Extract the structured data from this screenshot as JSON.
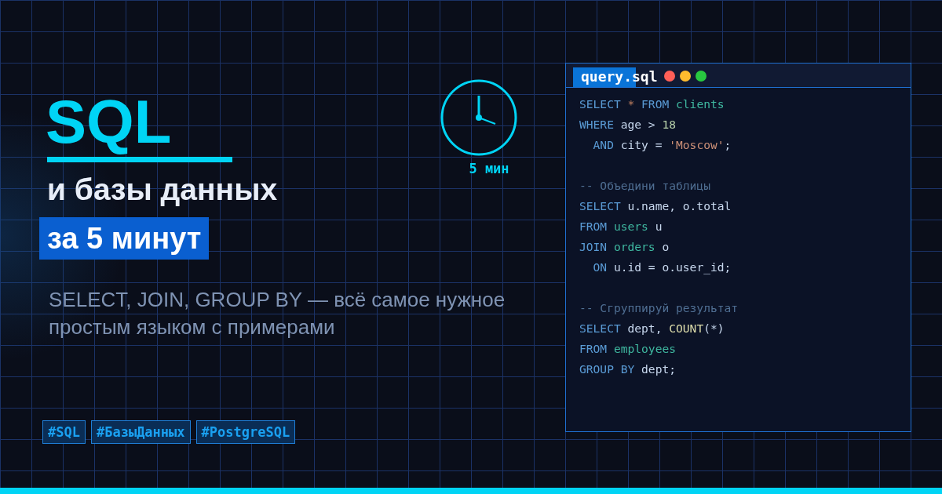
{
  "title": "SQL",
  "heading": "и базы данных",
  "badge": "за 5 минут",
  "subtitle": "SELECT, JOIN, GROUP BY — всё самое нужное простым языком с примерами",
  "tags": [
    "#SQL",
    "#БазыДанных",
    "#PostgreSQL"
  ],
  "timer": {
    "label": "5 мин"
  },
  "editor": {
    "tab": "query.sql",
    "lines": [
      {
        "kind": "code",
        "tokens": [
          {
            "kind": "kw",
            "text": "SELECT"
          },
          {
            "kind": "op",
            "text": " * "
          },
          {
            "kind": "kw",
            "text": "FROM"
          },
          {
            "kind": "tbl",
            "text": " clients"
          }
        ]
      },
      {
        "kind": "code",
        "tokens": [
          {
            "kind": "kw",
            "text": "WHERE"
          },
          {
            "kind": "id",
            "text": " age > "
          },
          {
            "kind": "num",
            "text": "18"
          }
        ]
      },
      {
        "kind": "code",
        "tokens": [
          {
            "kind": "kw",
            "text": "  AND"
          },
          {
            "kind": "id",
            "text": " city = "
          },
          {
            "kind": "str",
            "text": "'Moscow'"
          },
          {
            "kind": "id",
            "text": ";"
          }
        ]
      },
      {
        "kind": "blank"
      },
      {
        "kind": "code",
        "tokens": [
          {
            "kind": "cm",
            "text": "-- Объедини таблицы"
          }
        ]
      },
      {
        "kind": "code",
        "tokens": [
          {
            "kind": "kw",
            "text": "SELECT"
          },
          {
            "kind": "id",
            "text": " u.name, o.total"
          }
        ]
      },
      {
        "kind": "code",
        "tokens": [
          {
            "kind": "kw",
            "text": "FROM"
          },
          {
            "kind": "tbl",
            "text": " users"
          },
          {
            "kind": "id",
            "text": " u"
          }
        ]
      },
      {
        "kind": "code",
        "tokens": [
          {
            "kind": "kw",
            "text": "JOIN"
          },
          {
            "kind": "tbl",
            "text": " orders"
          },
          {
            "kind": "id",
            "text": " o"
          }
        ]
      },
      {
        "kind": "code",
        "tokens": [
          {
            "kind": "kw",
            "text": "  ON"
          },
          {
            "kind": "id",
            "text": " u.id = o.user_id;"
          }
        ]
      },
      {
        "kind": "blank"
      },
      {
        "kind": "code",
        "tokens": [
          {
            "kind": "cm",
            "text": "-- Сгруппируй результат"
          }
        ]
      },
      {
        "kind": "code",
        "tokens": [
          {
            "kind": "kw",
            "text": "SELECT"
          },
          {
            "kind": "id",
            "text": " dept, "
          },
          {
            "kind": "fn",
            "text": "COUNT"
          },
          {
            "kind": "id",
            "text": "(*)"
          }
        ]
      },
      {
        "kind": "code",
        "tokens": [
          {
            "kind": "kw",
            "text": "FROM"
          },
          {
            "kind": "tbl",
            "text": " employees"
          }
        ]
      },
      {
        "kind": "code",
        "tokens": [
          {
            "kind": "kw",
            "text": "GROUP BY"
          },
          {
            "kind": "id",
            "text": " dept;"
          }
        ]
      }
    ]
  }
}
